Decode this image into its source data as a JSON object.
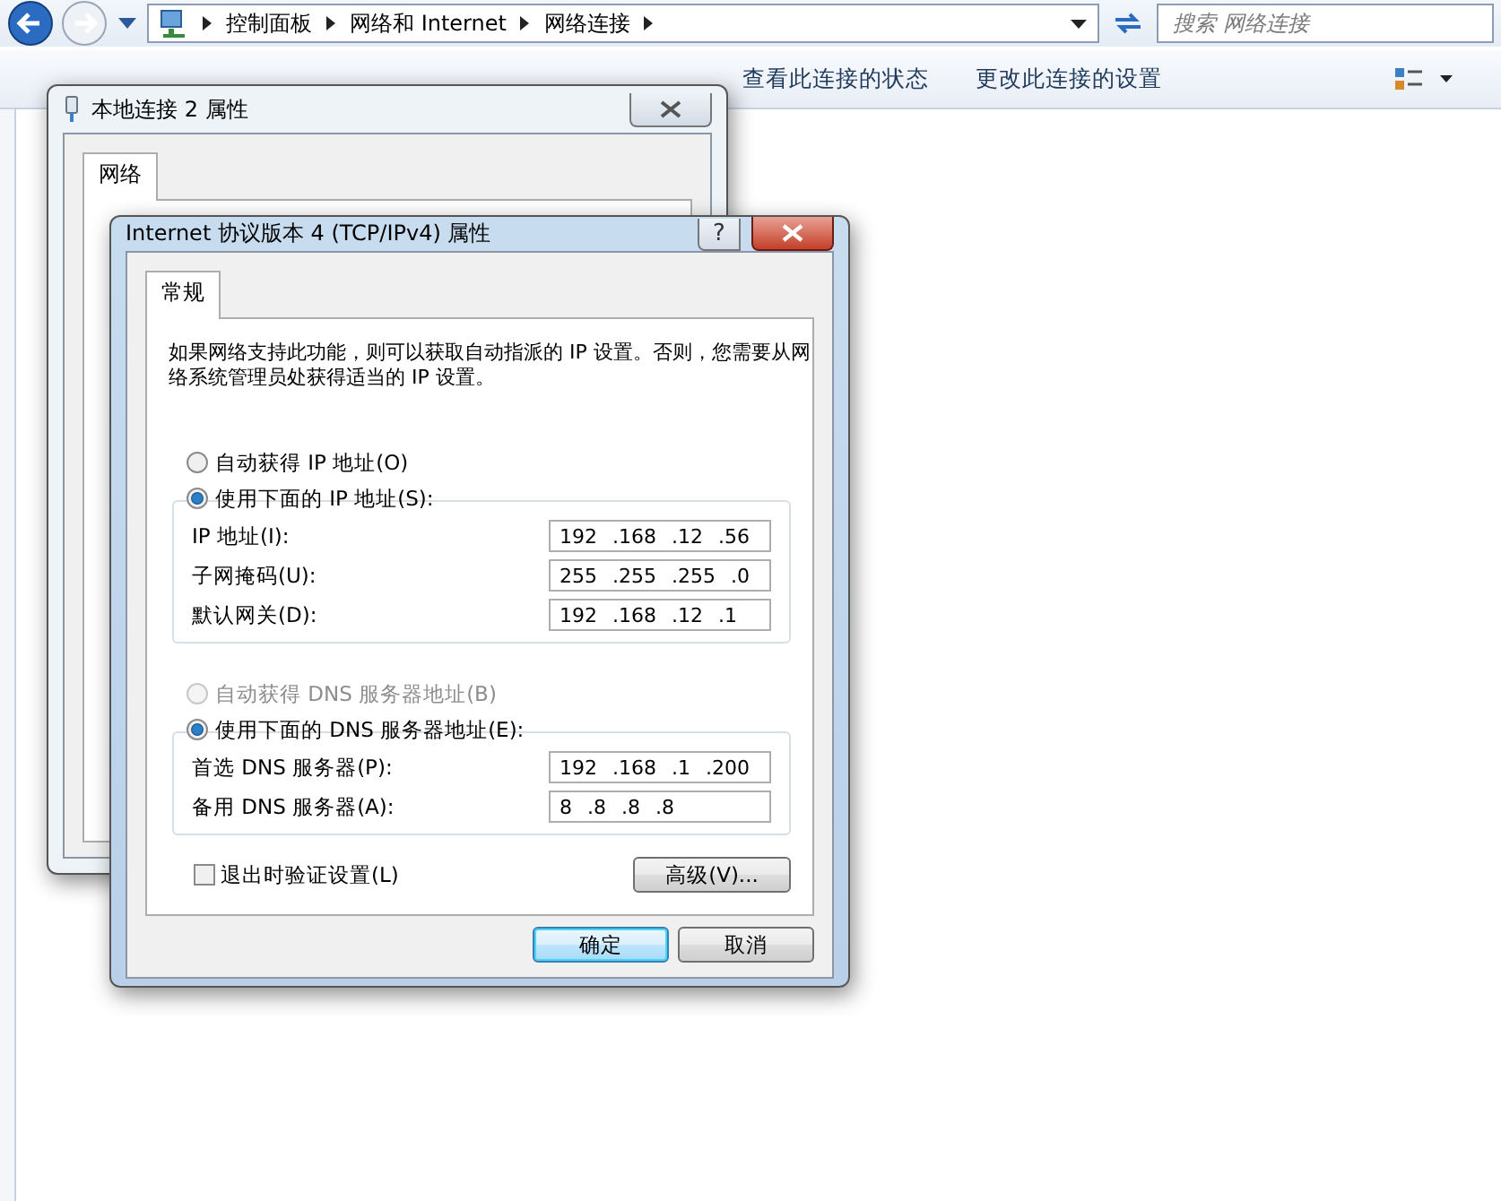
{
  "explorer": {
    "breadcrumb": [
      "控制面板",
      "网络和 Internet",
      "网络连接"
    ],
    "search": {
      "placeholder": "搜索 网络连接"
    },
    "toolbar": [
      {
        "label": "查看此连接的状态"
      },
      {
        "label": "更改此连接的设置"
      }
    ]
  },
  "back_dialog": {
    "title": "本地连接 2 属性",
    "tabs": [
      {
        "label": "网络",
        "selected": true
      }
    ]
  },
  "dialog": {
    "title": "Internet 协议版本 4 (TCP/IPv4) 属性",
    "help_button": "?",
    "tabs": [
      {
        "label": "常规",
        "selected": true
      }
    ],
    "intro": "如果网络支持此功能，则可以获取自动指派的 IP 设置。否则，您需要从网络系统管理员处获得适当的 IP 设置。",
    "ip_options": [
      {
        "label": "自动获得 IP 地址(O)",
        "selected": false,
        "disabled": false
      },
      {
        "label": "使用下面的 IP 地址(S):",
        "selected": true,
        "disabled": false
      }
    ],
    "ip_fields": [
      {
        "label": "IP 地址(I):",
        "value": "192 .168 .12 .56"
      },
      {
        "label": "子网掩码(U):",
        "value": "255 .255 .255 .0"
      },
      {
        "label": "默认网关(D):",
        "value": "192 .168 .12 .1"
      }
    ],
    "dns_options": [
      {
        "label": "自动获得 DNS 服务器地址(B)",
        "selected": false,
        "disabled": true
      },
      {
        "label": "使用下面的 DNS 服务器地址(E):",
        "selected": true,
        "disabled": false
      }
    ],
    "dns_fields": [
      {
        "label": "首选 DNS 服务器(P):",
        "value": "192 .168 .1 .200"
      },
      {
        "label": "备用 DNS 服务器(A):",
        "value": "8 .8 .8 .8"
      }
    ],
    "validate": {
      "label": "退出时验证设置(L)",
      "checked": false
    },
    "advanced_button": "高级(V)...",
    "buttons": [
      {
        "label": "确定",
        "default": true
      },
      {
        "label": "取消",
        "default": false
      }
    ]
  }
}
